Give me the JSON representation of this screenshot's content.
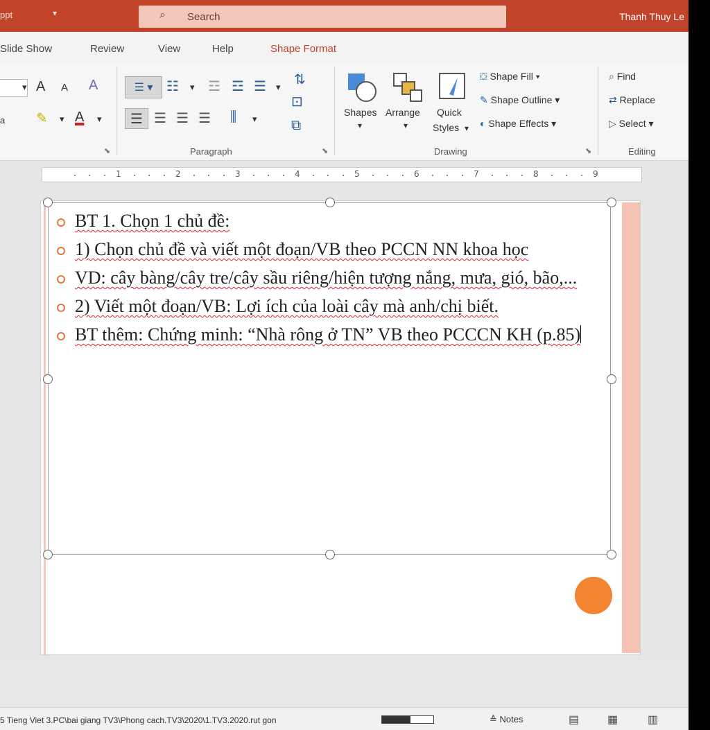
{
  "window": {
    "doc_name": "ppt",
    "quick_access_chevron": "▾",
    "search_placeholder": "Search",
    "user": "Thanh Thuy Le"
  },
  "tabs": [
    {
      "label": "Slide Show"
    },
    {
      "label": "Review"
    },
    {
      "label": "View"
    },
    {
      "label": "Help"
    },
    {
      "label": "Shape Format",
      "active": true
    }
  ],
  "ribbon": {
    "font": {
      "font_size_inc": "A",
      "font_size_dec": "A",
      "clear_format": "A",
      "font_color": "A",
      "highlight": "✎",
      "font_name_partial": "a"
    },
    "paragraph": {
      "label": "Paragraph"
    },
    "drawing": {
      "label": "Drawing",
      "shapes": "Shapes",
      "arrange": "Arrange",
      "quick_styles_1": "Quick",
      "quick_styles_2": "Styles",
      "shape_fill": "Shape Fill",
      "shape_outline": "Shape Outline",
      "shape_effects": "Shape Effects"
    },
    "editing": {
      "label": "Editing",
      "find": "Find",
      "replace": "Replace",
      "select": "Select"
    }
  },
  "ruler": {
    "numbers": [
      "1",
      "2",
      "3",
      "4",
      "5",
      "6",
      "7",
      "8",
      "9"
    ]
  },
  "slide": {
    "bullets": [
      {
        "text": "BT 1. Chọn 1 chủ đề:"
      },
      {
        "text": "1) Chọn chủ đề và viết một đoạn/VB theo PCCN NN khoa học"
      },
      {
        "text": "VD: cây bàng/cây tre/cây sầu riêng/hiện tượng nắng, mưa, gió, bão,..."
      },
      {
        "text": "2) Viết một đoạn/VB: Lợi ích của loài cây mà anh/chị biết."
      },
      {
        "text": "BT thêm: Chứng minh: “Nhà rông ở TN” VB theo PCCCN KH (p.85)"
      }
    ],
    "accent_color": "#f38430"
  },
  "statusbar": {
    "path": "5 Tieng Viet 3.PC\\bai giang TV3\\Phong cach.TV3\\2020\\1.TV3.2020.rut gon",
    "progress": 0.55,
    "notes": "Notes"
  },
  "colors": {
    "titlebar": "#c0432a",
    "active_tab": "#c0432a"
  }
}
